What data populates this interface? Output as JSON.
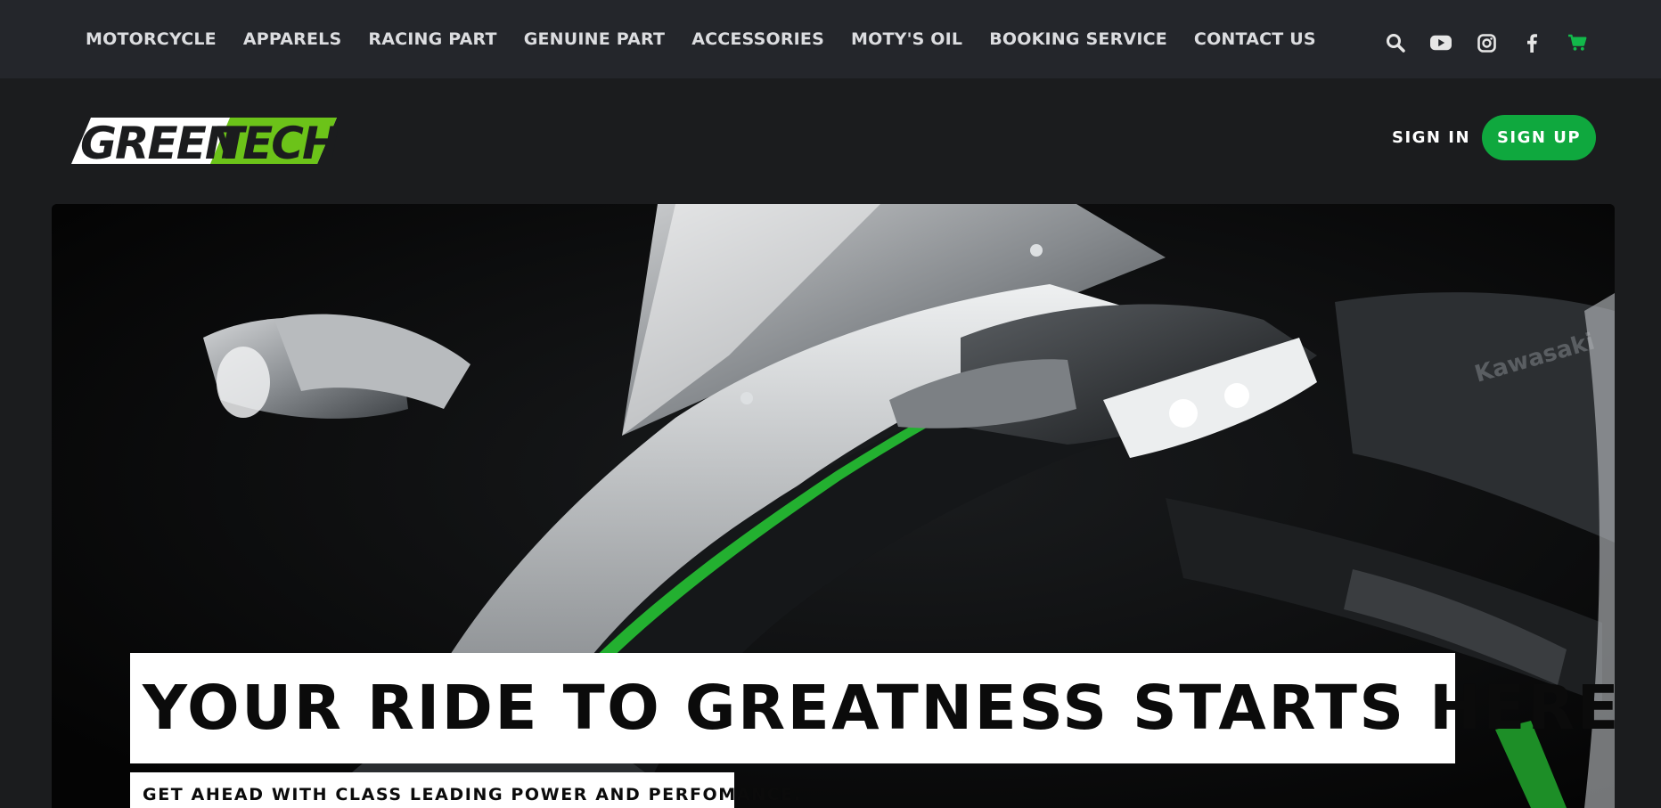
{
  "nav": {
    "items": [
      "MOTORCYCLE",
      "APPARELS",
      "RACING PART",
      "GENUINE PART",
      "ACCESSORIES",
      "MOTY'S OIL",
      "BOOKING SERVICE",
      "CONTACT US"
    ],
    "icons": [
      "search-icon",
      "youtube-icon",
      "instagram-icon",
      "facebook-icon",
      "cart-icon"
    ]
  },
  "brand": {
    "logo_white": "GREEN",
    "logo_green": "TECH",
    "accent_color": "#0fa83e",
    "logo_green_color": "#6cc319"
  },
  "auth": {
    "sign_in": "SIGN IN",
    "sign_up": "SIGN UP"
  },
  "hero": {
    "headline": "YOUR RIDE TO GREATNESS STARTS HERE",
    "subline": "GET AHEAD WITH CLASS LEADING POWER AND PERFOMANCE."
  }
}
